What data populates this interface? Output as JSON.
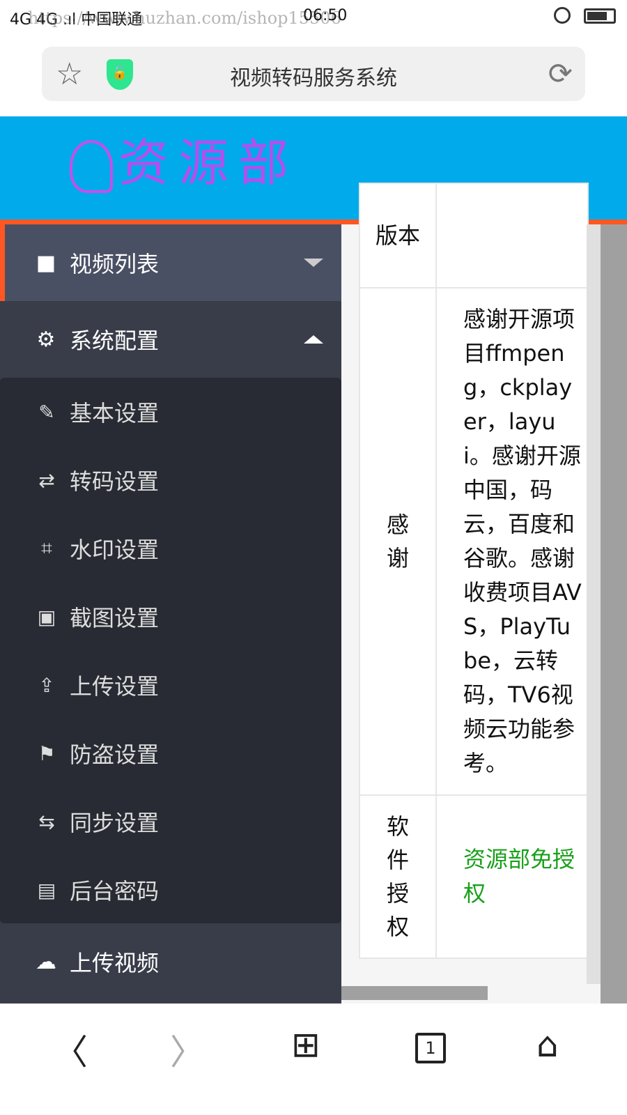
{
  "status": {
    "carrier": "4G 4G .ıl 中国联通",
    "time": "06:50",
    "watermark": "https://www.huzhan.com/ishop15506"
  },
  "browser": {
    "title": "视频转码服务系统"
  },
  "header": {
    "logo_text": "资源部"
  },
  "sidebar": {
    "video_list": "视频列表",
    "system_config": "系统配置",
    "sub_items": [
      {
        "label": "基本设置",
        "icon": "edit-icon",
        "glyph": "✎"
      },
      {
        "label": "转码设置",
        "icon": "retweet-icon",
        "glyph": "⇄"
      },
      {
        "label": "水印设置",
        "icon": "crop-icon",
        "glyph": "⌗"
      },
      {
        "label": "截图设置",
        "icon": "image-icon",
        "glyph": "▣"
      },
      {
        "label": "上传设置",
        "icon": "upload-icon",
        "glyph": "⇪"
      },
      {
        "label": "防盗设置",
        "icon": "flag-icon",
        "glyph": "⚑"
      },
      {
        "label": "同步设置",
        "icon": "exchange-icon",
        "glyph": "⇆"
      },
      {
        "label": "后台密码",
        "icon": "contact-icon",
        "glyph": "▤"
      }
    ],
    "upload_video": "上传视频"
  },
  "table": {
    "rows": [
      {
        "key": "版本",
        "value": ""
      },
      {
        "key": "感谢",
        "value": "感谢开源项目ffmpeng，ckplayer，layui。感谢开源中国，码云，百度和谷歌。感谢收费项目AVS，PlayTube，云转码，TV6视频云功能参考。"
      },
      {
        "key": "软件授权",
        "value": "资源部免授权"
      }
    ]
  },
  "bottom_nav": {
    "tab_count": "1"
  },
  "colors": {
    "header": "#00aaeb",
    "accent": "#ff5722",
    "sidebar": "#393d49",
    "submenu": "#282b33",
    "license": "#1aa01a"
  }
}
